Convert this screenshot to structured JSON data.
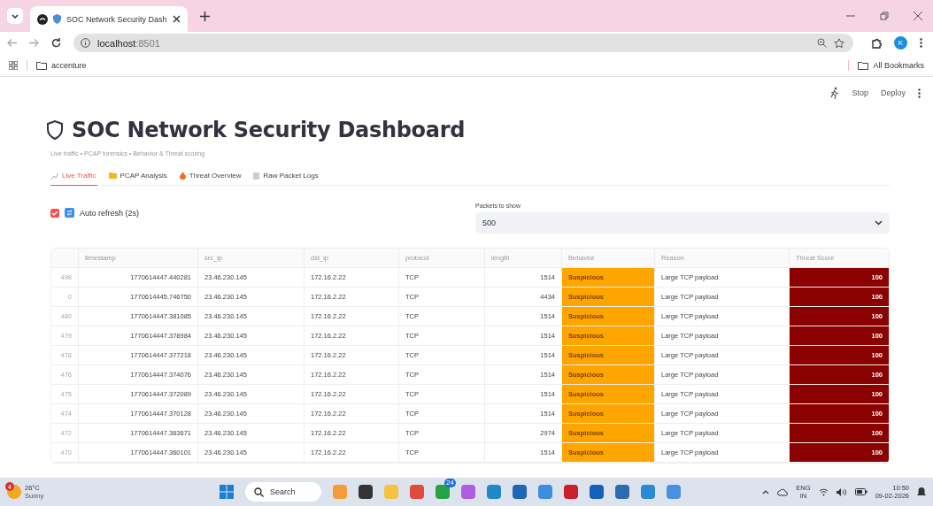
{
  "browser": {
    "tab_title": "SOC Network Security Dash",
    "url_host": "localhost",
    "url_port": ":8501",
    "bookmarks": [
      "accenture"
    ],
    "all_bookmarks": "All Bookmarks",
    "profile_initial": "K"
  },
  "app_toolbar": {
    "stop": "Stop",
    "deploy": "Deploy"
  },
  "title": "SOC Network Security Dashboard",
  "subtitle": "Live traffic • PCAP forensics • Behavior & Threat scoring",
  "tabs": [
    {
      "label": "Live Traffic",
      "kind": "chart",
      "selected": true
    },
    {
      "label": "PCAP Analysis",
      "kind": "folder",
      "selected": false
    },
    {
      "label": "Threat Overview",
      "kind": "fire",
      "selected": false
    },
    {
      "label": "Raw Packet Logs",
      "kind": "log",
      "selected": false
    }
  ],
  "auto_refresh": {
    "label": "Auto refresh (2s)",
    "checked": true
  },
  "packets_select": {
    "label": "Packets to show",
    "value": "500"
  },
  "table": {
    "columns": [
      {
        "kind": "index"
      },
      {
        "label": "timestamp",
        "kind": "number"
      },
      {
        "label": "src_ip",
        "kind": "text"
      },
      {
        "label": "dst_ip",
        "kind": "text"
      },
      {
        "label": "protocol",
        "kind": "text"
      },
      {
        "label": "length",
        "kind": "number"
      },
      {
        "label": "Behavior",
        "kind": "behavior"
      },
      {
        "label": "Reason",
        "kind": "text"
      },
      {
        "label": "Threat Score",
        "kind": "score"
      }
    ],
    "rows": [
      [
        "498",
        "1770614447.440281",
        "23.46.230.145",
        "172.16.2.22",
        "TCP",
        "1514",
        "Suspicious",
        "Large TCP payload",
        "100"
      ],
      [
        "0",
        "1770614445.746750",
        "23.46.230.145",
        "172.16.2.22",
        "TCP",
        "4434",
        "Suspicious",
        "Large TCP payload",
        "100"
      ],
      [
        "480",
        "1770614447.381085",
        "23.46.230.145",
        "172.16.2.22",
        "TCP",
        "1514",
        "Suspicious",
        "Large TCP payload",
        "100"
      ],
      [
        "479",
        "1770614447.378984",
        "23.46.230.145",
        "172.16.2.22",
        "TCP",
        "1514",
        "Suspicious",
        "Large TCP payload",
        "100"
      ],
      [
        "478",
        "1770614447.377218",
        "23.46.230.145",
        "172.16.2.22",
        "TCP",
        "1514",
        "Suspicious",
        "Large TCP payload",
        "100"
      ],
      [
        "476",
        "1770614447.374076",
        "23.46.230.145",
        "172.16.2.22",
        "TCP",
        "1514",
        "Suspicious",
        "Large TCP payload",
        "100"
      ],
      [
        "475",
        "1770614447.372089",
        "23.46.230.145",
        "172.16.2.22",
        "TCP",
        "1514",
        "Suspicious",
        "Large TCP payload",
        "100"
      ],
      [
        "474",
        "1770614447.370128",
        "23.46.230.145",
        "172.16.2.22",
        "TCP",
        "1514",
        "Suspicious",
        "Large TCP payload",
        "100"
      ],
      [
        "472",
        "1770614447.363671",
        "23.46.230.145",
        "172.16.2.22",
        "TCP",
        "2974",
        "Suspicious",
        "Large TCP payload",
        "100"
      ],
      [
        "470",
        "1770614447.360101",
        "23.46.230.145",
        "172.16.2.22",
        "TCP",
        "1514",
        "Suspicious",
        "Large TCP payload",
        "100"
      ]
    ]
  },
  "taskbar": {
    "weather_badge": "4",
    "temperature": "26°C",
    "condition": "Sunny",
    "search": "Search",
    "apps": [
      {
        "color": "#f29d38"
      },
      {
        "color": "#333333"
      },
      {
        "color": "#f5c242"
      },
      {
        "color": "#e04a3a"
      },
      {
        "color": "#25a244",
        "badge": "24"
      },
      {
        "color": "#b05ce0"
      },
      {
        "color": "#1e88c8"
      },
      {
        "color": "#2066b8"
      },
      {
        "color": "#3b8de0"
      },
      {
        "color": "#c8202c"
      },
      {
        "color": "#1560bd"
      },
      {
        "color": "#2b6cb0"
      },
      {
        "color": "#2a8ad8"
      },
      {
        "color": "#4a90e2"
      }
    ],
    "lang": "ENG",
    "region": "IN",
    "time": "10:50",
    "date": "09-02-2026"
  }
}
